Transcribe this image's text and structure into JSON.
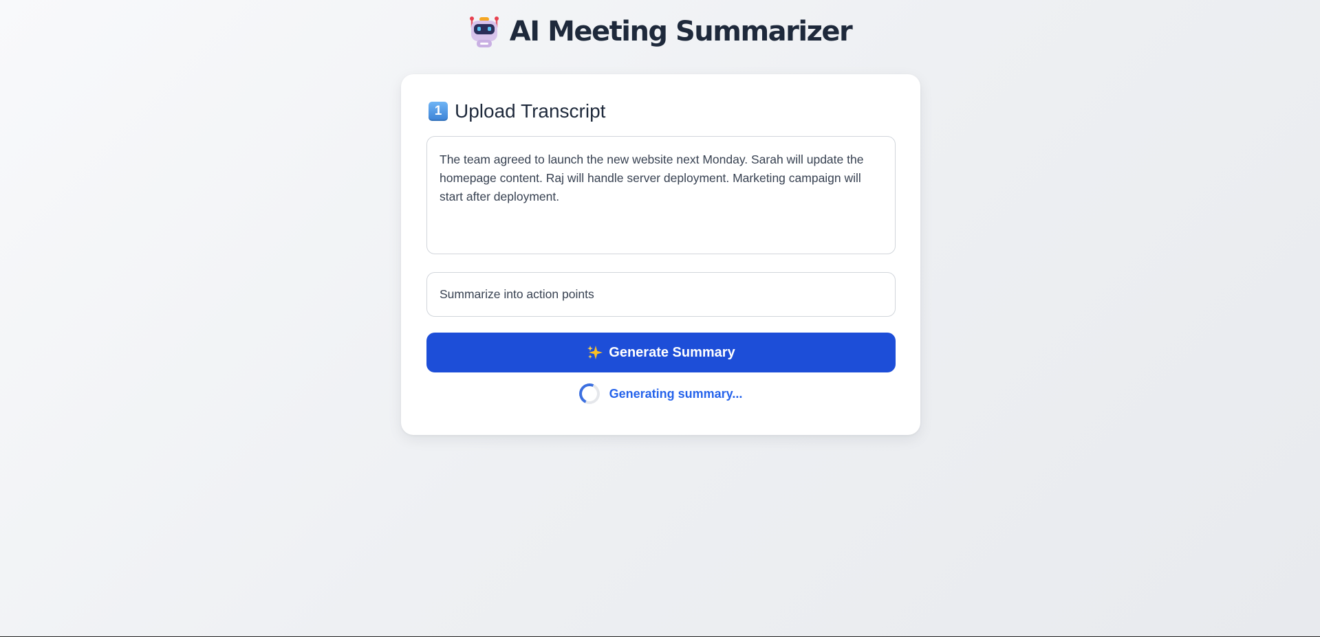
{
  "header": {
    "icon": "robot-icon",
    "title": "AI Meeting Summarizer"
  },
  "upload": {
    "step_icon": "keycap-1-icon",
    "step_number": "1",
    "title": "Upload Transcript",
    "transcript_value": "The team agreed to launch the new website next Monday. Sarah will update the homepage content. Raj will handle server deployment. Marketing campaign will start after deployment.",
    "prompt_value": "Summarize into action points"
  },
  "actions": {
    "generate_icon": "sparkles-icon",
    "generate_label": "Generate Summary"
  },
  "status": {
    "icon": "spinner-icon",
    "text": "Generating summary..."
  },
  "colors": {
    "accent": "#1d4ed8",
    "status_text": "#2563eb",
    "title_text": "#1e293b"
  }
}
